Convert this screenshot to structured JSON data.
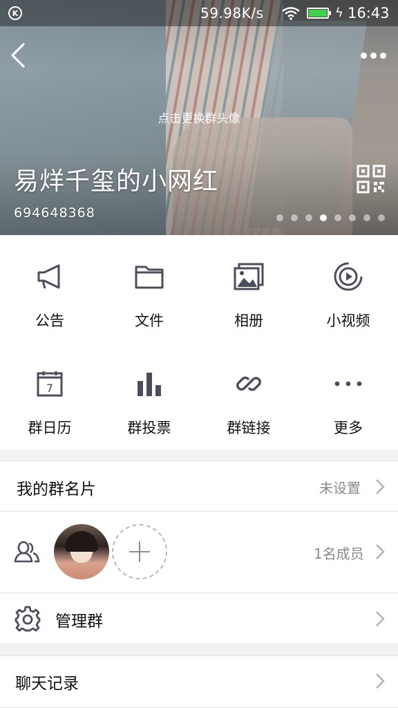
{
  "status_bar": {
    "net_speed": "59.98K/s",
    "time": "16:43",
    "left_icon": "k-circle-icon",
    "battery_color": "#3fd24a"
  },
  "header": {
    "change_avatar_hint": "点击更换群头像",
    "group_name": "易烊千玺的小网红",
    "group_id": "694648368",
    "page_dots": {
      "count": 8,
      "active_index": 3
    }
  },
  "features": [
    {
      "label": "公告",
      "icon": "megaphone-icon"
    },
    {
      "label": "文件",
      "icon": "folder-icon"
    },
    {
      "label": "相册",
      "icon": "album-icon"
    },
    {
      "label": "小视频",
      "icon": "video-icon"
    },
    {
      "label": "群日历",
      "icon": "calendar-icon"
    },
    {
      "label": "群投票",
      "icon": "bar-chart-icon"
    },
    {
      "label": "群链接",
      "icon": "link-icon"
    },
    {
      "label": "更多",
      "icon": "more-dots-icon"
    }
  ],
  "calendar_day": "7",
  "my_card": {
    "title": "我的群名片",
    "value": "未设置"
  },
  "members": {
    "count_text": "1名成员"
  },
  "manage": {
    "title": "管理群"
  },
  "chat_history": {
    "title": "聊天记录"
  },
  "colors": {
    "icon_gray": "#4a4e5c",
    "divider": "#e3e3e6",
    "section_bg": "#f2f2f4"
  }
}
